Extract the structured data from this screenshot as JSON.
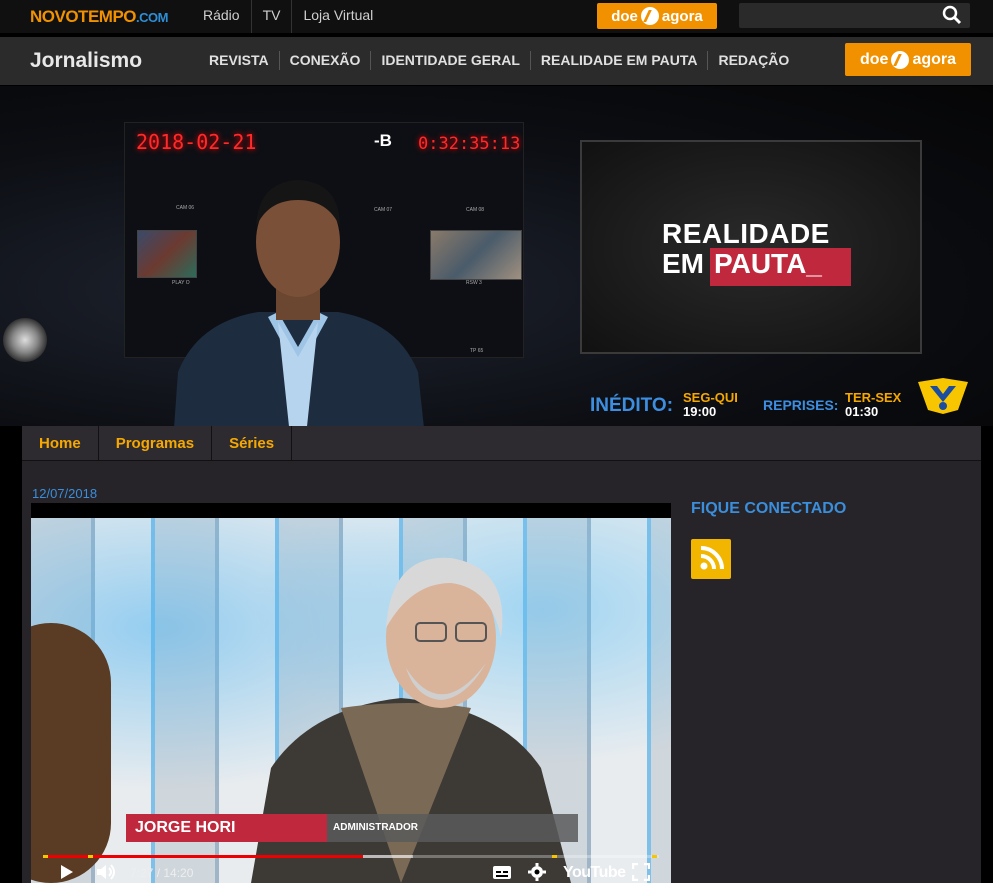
{
  "top": {
    "logo_brand": "NOVOTEMPO",
    "logo_domain": ".COM",
    "links": [
      "Rádio",
      "TV",
      "Loja Virtual"
    ],
    "donate_a": "doe",
    "donate_b": "agora",
    "search_placeholder": ""
  },
  "section": {
    "title": "Jornalismo",
    "nav": [
      "REVISTA",
      "CONEXÃO",
      "IDENTIDADE GERAL",
      "REALIDADE EM PAUTA",
      "REDAÇÃO"
    ],
    "donate_a": "doe",
    "donate_b": "agora"
  },
  "banner": {
    "clock_date": "2018-02-21",
    "clock_b": "-B",
    "clock_time": "0:32:35:13",
    "cam_labels": [
      "CAM 06",
      "CAM 07",
      "CAM 08",
      "PLAY O",
      "RSW 3",
      "TP 65"
    ],
    "show_line1": "REALIDADE",
    "show_line2a": "EM",
    "show_line2b": "PAUTA_",
    "inedito_label": "INÉDITO:",
    "inedito_days": "SEG-QUI",
    "inedito_time": "19:00",
    "reprises_label": "REPRISES:",
    "reprises_days": "TER-SEX",
    "reprises_time": "01:30"
  },
  "tabs": [
    "Home",
    "Programas",
    "Séries"
  ],
  "post": {
    "date": "12/07/2018",
    "video": {
      "name": "JORGE HORI",
      "role": "ADMINISTRADOR",
      "time": "7:27 / 14:20",
      "progress": 0.52,
      "buffered": 0.6,
      "youtube": "YouTube"
    }
  },
  "sidebar": {
    "title": "FIQUE CONECTADO"
  },
  "colors": {
    "accent": "#f29100",
    "link_blue": "#3a8edb",
    "tab_yellow": "#f7a800",
    "show_red": "#c0293d"
  }
}
